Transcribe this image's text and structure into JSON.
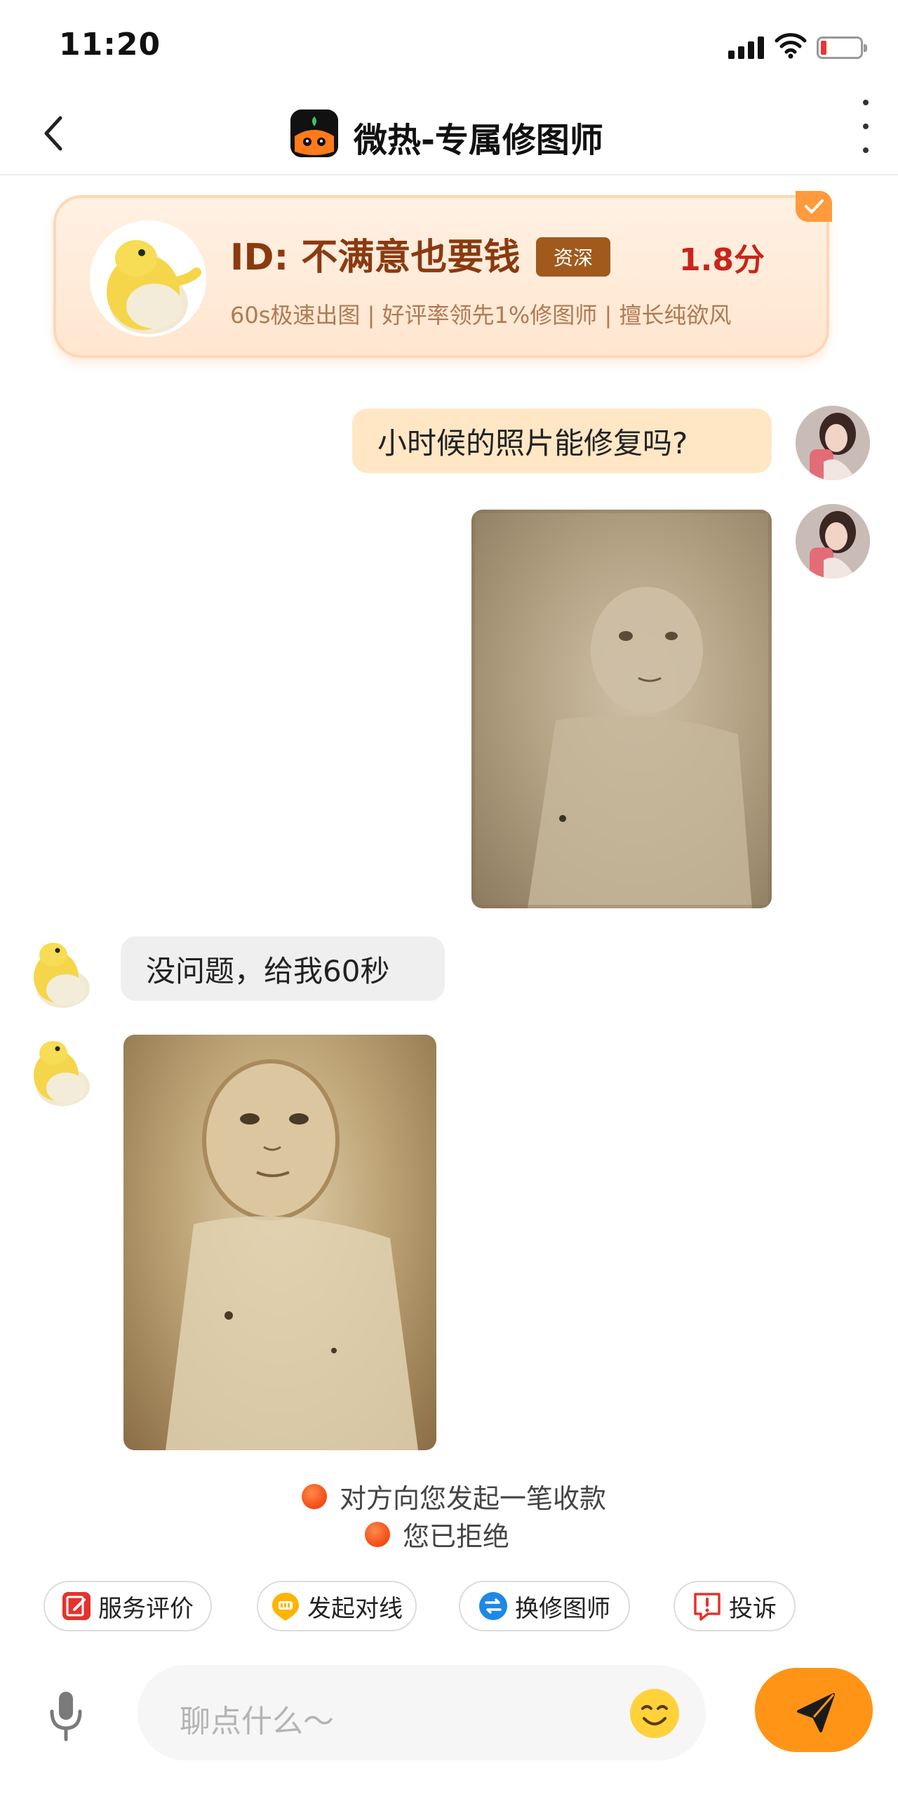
{
  "status_bar": {
    "time": "11:20"
  },
  "header": {
    "title": "微热-专属修图师"
  },
  "profile": {
    "id_text": "ID: 不满意也要钱",
    "badge": "资深",
    "rating": "1.8分",
    "description": "60s极速出图 | 好评率领先1%修图师 | 擅长纯欲风"
  },
  "messages": [
    {
      "from": "user",
      "type": "text",
      "text": "小时候的照片能修复吗?"
    },
    {
      "from": "user",
      "type": "image",
      "image": "old-baby-photo"
    },
    {
      "from": "retoucher",
      "type": "text",
      "text": "没问题，给我60秒"
    },
    {
      "from": "retoucher",
      "type": "image",
      "image": "restored-baby-photo"
    }
  ],
  "notices": [
    {
      "text": "对方向您发起一笔收款"
    },
    {
      "text": "您已拒绝"
    }
  ],
  "quick_actions": [
    {
      "label": "服务评价",
      "icon": "edit-icon"
    },
    {
      "label": "发起对线",
      "icon": "fight-icon"
    },
    {
      "label": "换修图师",
      "icon": "switch-icon"
    },
    {
      "label": "投诉",
      "icon": "alert-icon"
    }
  ],
  "input": {
    "placeholder": "聊点什么～"
  },
  "colors": {
    "accent_orange": "#ff9416",
    "user_bubble": "#ffe7c5",
    "bot_bubble": "#efefef",
    "rating_red": "#c8251b",
    "profile_brown": "#8a3a10"
  }
}
